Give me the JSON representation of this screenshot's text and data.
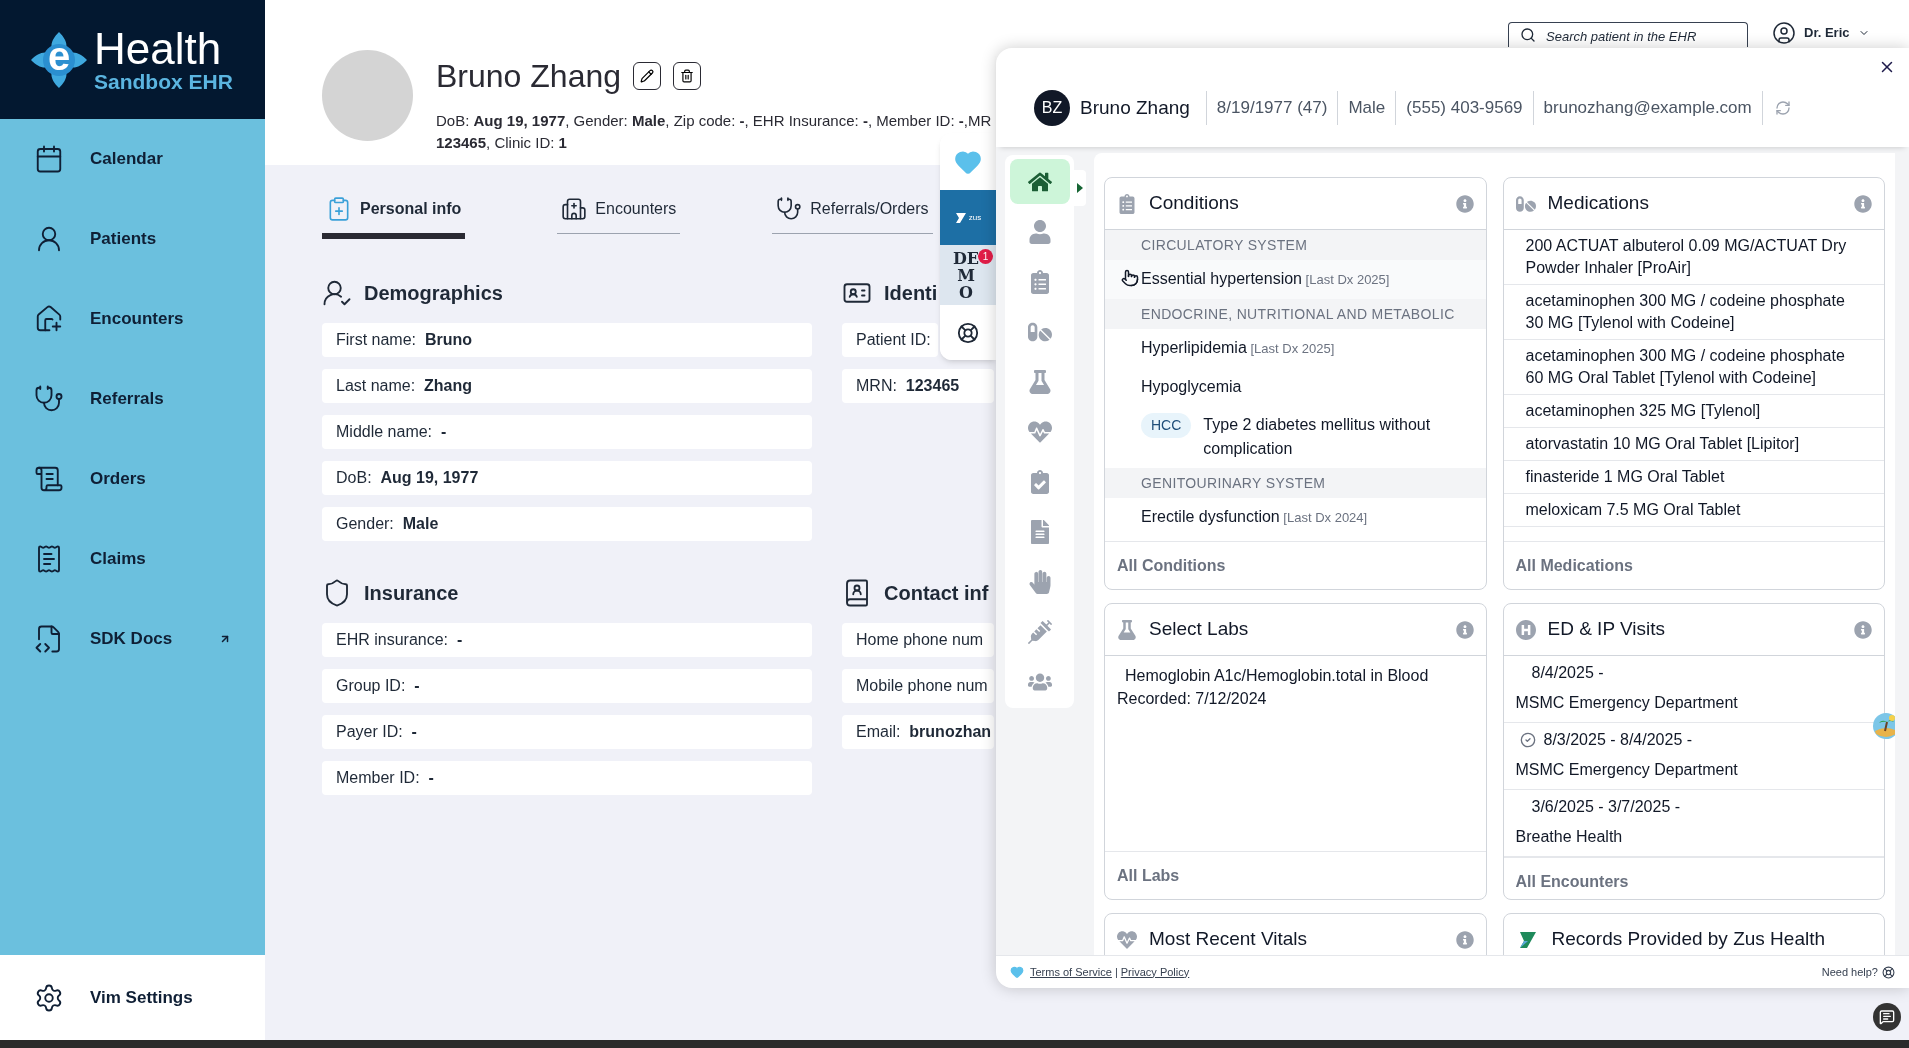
{
  "sidebar": {
    "logo": {
      "letter": "e",
      "title": "Health",
      "subtitle": "Sandbox EHR"
    },
    "items": [
      {
        "label": "Calendar",
        "selected": false,
        "external": false
      },
      {
        "label": "Patients",
        "selected": false,
        "external": false
      },
      {
        "label": "Encounters",
        "selected": false,
        "external": false
      },
      {
        "label": "Referrals",
        "selected": false,
        "external": false
      },
      {
        "label": "Orders",
        "selected": false,
        "external": false
      },
      {
        "label": "Claims",
        "selected": false,
        "external": false
      },
      {
        "label": "SDK Docs",
        "selected": false,
        "external": true
      }
    ],
    "settings": {
      "label": "Vim Settings"
    }
  },
  "topbar": {
    "search": {
      "placeholder": "Search patient in the EHR"
    },
    "user": {
      "name": "Dr. Eric"
    }
  },
  "patient": {
    "name": "Bruno Zhang",
    "details": [
      "DoB: **Aug 19, 1977**, Gender: **Male**, Zip code: **-**, EHR Insurance: **-**, Member ID: **-**,MR",
      "**123465**, Clinic ID: **1**"
    ]
  },
  "tabs": [
    {
      "label": "Personal info",
      "selected": true
    },
    {
      "label": "Encounters",
      "selected": false
    },
    {
      "label": "Referrals/Orders",
      "selected": false
    }
  ],
  "sections": [
    {
      "title": "Demographics",
      "fields": [
        "First name:  **Bruno**",
        "Last name:  **Zhang**",
        "Middle name:  **-**",
        "DoB:  **Aug 19, 1977**",
        "Gender:  **Male**"
      ]
    },
    {
      "title": "Identi",
      "fields": [
        "Patient ID:",
        "MRN:  **123465**"
      ]
    },
    {
      "title": "Insurance",
      "fields": [
        "EHR insurance:  **-**",
        "Group ID:  **-**",
        "Payer ID:  **-**",
        "Member ID:  **-**"
      ]
    },
    {
      "title": "Contact inf",
      "fields": [
        "Home phone num",
        "Mobile phone num",
        "Email:  **brunozhan**"
      ]
    }
  ],
  "toolbar": [
    {
      "kind": "heart",
      "selected": false
    },
    {
      "kind": "zus",
      "selected": true,
      "text": "zus"
    },
    {
      "kind": "demo",
      "selected": false,
      "text": "DEMO",
      "badge": "1"
    },
    {
      "kind": "help",
      "selected": false
    }
  ],
  "panel": {
    "patient": {
      "initials": "BZ",
      "name": "Bruno Zhang",
      "facts": [
        "8/19/1977 (47)",
        "Male",
        "(555) 403-9569",
        "brunozhang@example.com"
      ]
    },
    "rail": [
      {
        "selected": true
      },
      {
        "selected": false
      },
      {
        "selected": false
      },
      {
        "selected": false
      },
      {
        "selected": false
      },
      {
        "selected": false
      },
      {
        "selected": false
      },
      {
        "selected": false
      },
      {
        "selected": false
      },
      {
        "selected": false
      },
      {
        "selected": false
      }
    ],
    "cards": [
      {
        "kind": "conditions",
        "title": "Conditions",
        "groups": [
          {
            "heading": "CIRCULATORY SYSTEM",
            "items": [
              {
                "name": "Essential hypertension",
                "note": "[Last Dx 2025]",
                "hovered": true
              }
            ]
          },
          {
            "heading": "ENDOCRINE, NUTRITIONAL AND METABOLIC",
            "items": [
              {
                "name": "Hyperlipidemia",
                "note": "[Last Dx 2025]",
                "hovered": false
              },
              {
                "name": "Hypoglycemia",
                "hovered": false
              },
              {
                "name": "Type 2 diabetes mellitus without complication",
                "tag": "HCC",
                "hovered": false
              }
            ]
          },
          {
            "heading": "GENITOURINARY SYSTEM",
            "items": [
              {
                "name": "Erectile dysfunction",
                "note": "[Last Dx 2024]",
                "hovered": false
              }
            ]
          }
        ],
        "footer": "All Conditions"
      },
      {
        "kind": "medications",
        "title": "Medications",
        "items": [
          "200 ACTUAT albuterol 0.09 MG/ACTUAT Dry Powder Inhaler [ProAir]",
          "acetaminophen 300 MG / codeine phosphate 30 MG [Tylenol with Codeine]",
          "acetaminophen 300 MG / codeine phosphate 60 MG Oral Tablet [Tylenol with Codeine]",
          "acetaminophen 325 MG [Tylenol]",
          "atorvastatin 10 MG Oral Tablet [Lipitor]",
          "finasteride 1 MG Oral Tablet",
          "meloxicam 7.5 MG Oral Tablet"
        ],
        "footer": "All Medications"
      },
      {
        "kind": "labs",
        "title": "Select Labs",
        "items": [
          {
            "name": "Hemoglobin A1c/Hemoglobin.total in Blood",
            "recorded": "Recorded: 7/12/2024"
          }
        ],
        "footer": "All Labs"
      },
      {
        "kind": "visits",
        "title": "ED & IP Visits",
        "items": [
          {
            "dates": "8/4/2025 -",
            "place": "MSMC Emergency Department",
            "checked": false
          },
          {
            "dates": "8/3/2025 - 8/4/2025 -",
            "place": "MSMC Emergency Department",
            "checked": true
          },
          {
            "dates": "3/6/2025 - 3/7/2025 -",
            "place": "Breathe Health",
            "checked": false
          }
        ],
        "footer": "All Encounters"
      },
      {
        "kind": "vitals",
        "title": "Most Recent Vitals"
      },
      {
        "kind": "zus",
        "title": "Records Provided by Zus Health"
      }
    ],
    "footer": {
      "links": [
        "Terms of Service",
        "Privacy Policy"
      ],
      "separator": "|",
      "help": "Need help?"
    }
  }
}
